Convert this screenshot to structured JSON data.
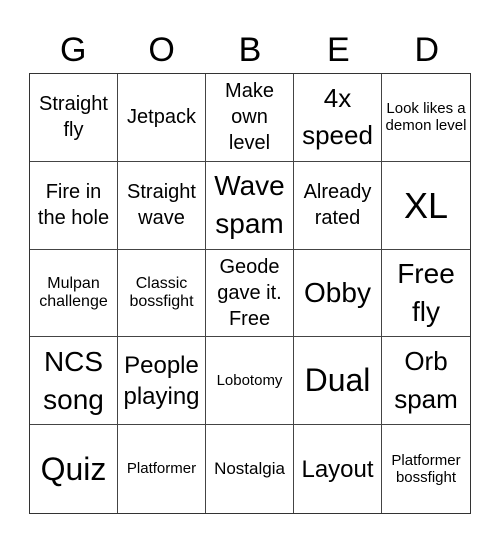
{
  "header": {
    "letters": [
      "G",
      "O",
      "B",
      "E",
      "D"
    ]
  },
  "cells": [
    "Straight fly",
    "Jetpack",
    "Make own level",
    "4x speed",
    "Look likes a demon level",
    "Fire in the hole",
    "Straight wave",
    "Wave spam",
    "Already rated",
    "XL",
    "Mulpan challenge",
    "Classic bossfight",
    "Geode gave it. Free",
    "Obby",
    "Free fly",
    "NCS song",
    "People playing",
    "Lobotomy",
    "Dual",
    "Orb spam",
    "Quiz",
    "Platformer",
    "Nostalgia",
    "Layout",
    "Platformer bossfight"
  ]
}
